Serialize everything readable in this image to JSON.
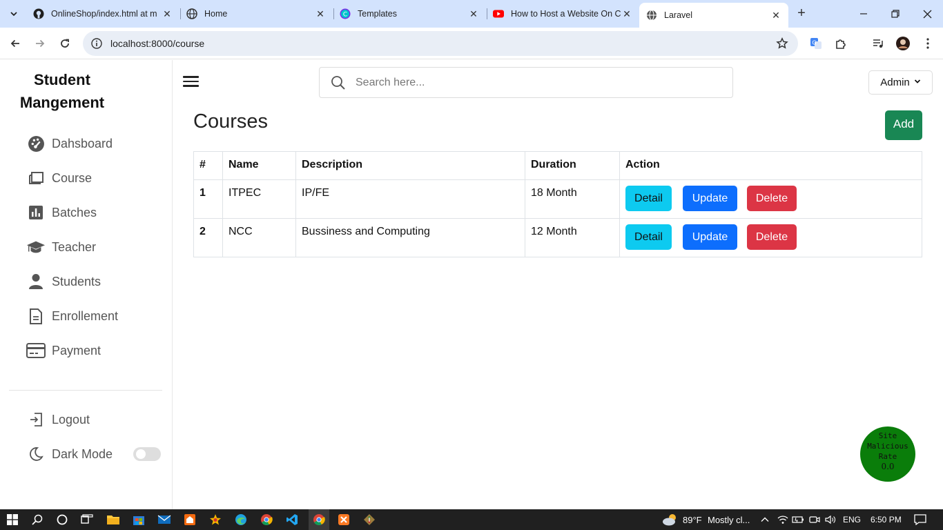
{
  "browser": {
    "tabs": [
      {
        "title": "OnlineShop/index.html at m",
        "icon": "github-icon"
      },
      {
        "title": "Home",
        "icon": "globe-icon"
      },
      {
        "title": "Templates",
        "icon": "canva-icon"
      },
      {
        "title": "How to Host a Website On C",
        "icon": "youtube-icon"
      },
      {
        "title": "Laravel",
        "icon": "globe-icon",
        "active": true
      }
    ],
    "url": "localhost:8000/course"
  },
  "sidebar": {
    "brand_line1": "Student",
    "brand_line2": "Mangement",
    "items": [
      {
        "label": "Dahsboard",
        "icon": "dashboard-gauge-icon"
      },
      {
        "label": "Course",
        "icon": "book-icon"
      },
      {
        "label": "Batches",
        "icon": "bar-chart-icon"
      },
      {
        "label": "Teacher",
        "icon": "graduation-cap-icon"
      },
      {
        "label": "Students",
        "icon": "user-icon"
      },
      {
        "label": "Enrollement",
        "icon": "document-icon"
      },
      {
        "label": "Payment",
        "icon": "credit-card-icon"
      }
    ],
    "logout_label": "Logout",
    "dark_mode_label": "Dark Mode",
    "dark_mode_on": false
  },
  "header": {
    "search_placeholder": "Search here...",
    "admin_label": "Admin"
  },
  "main": {
    "title": "Courses",
    "add_label": "Add",
    "columns": [
      "#",
      "Name",
      "Description",
      "Duration",
      "Action"
    ],
    "rows": [
      {
        "num": "1",
        "name": "ITPEC",
        "description": "IP/FE",
        "duration": "18 Month"
      },
      {
        "num": "2",
        "name": "NCC",
        "description": "Bussiness and Computing",
        "duration": "12 Month"
      }
    ],
    "actions": {
      "detail": "Detail",
      "update": "Update",
      "delete": "Delete"
    }
  },
  "badge": {
    "line1": "Site",
    "line2": "Malicious",
    "line3": "Rate",
    "value": "0.0"
  },
  "taskbar": {
    "weather_temp": "89°F",
    "weather_text": "Mostly cl...",
    "language": "ENG",
    "time": "6:50 PM"
  },
  "colors": {
    "add_button": "#198754",
    "detail_button": "#0dcaf0",
    "update_button": "#0d6efd",
    "delete_button": "#dc3545",
    "tabstrip": "#d3e3fd",
    "badge": "#0a7d0a"
  }
}
